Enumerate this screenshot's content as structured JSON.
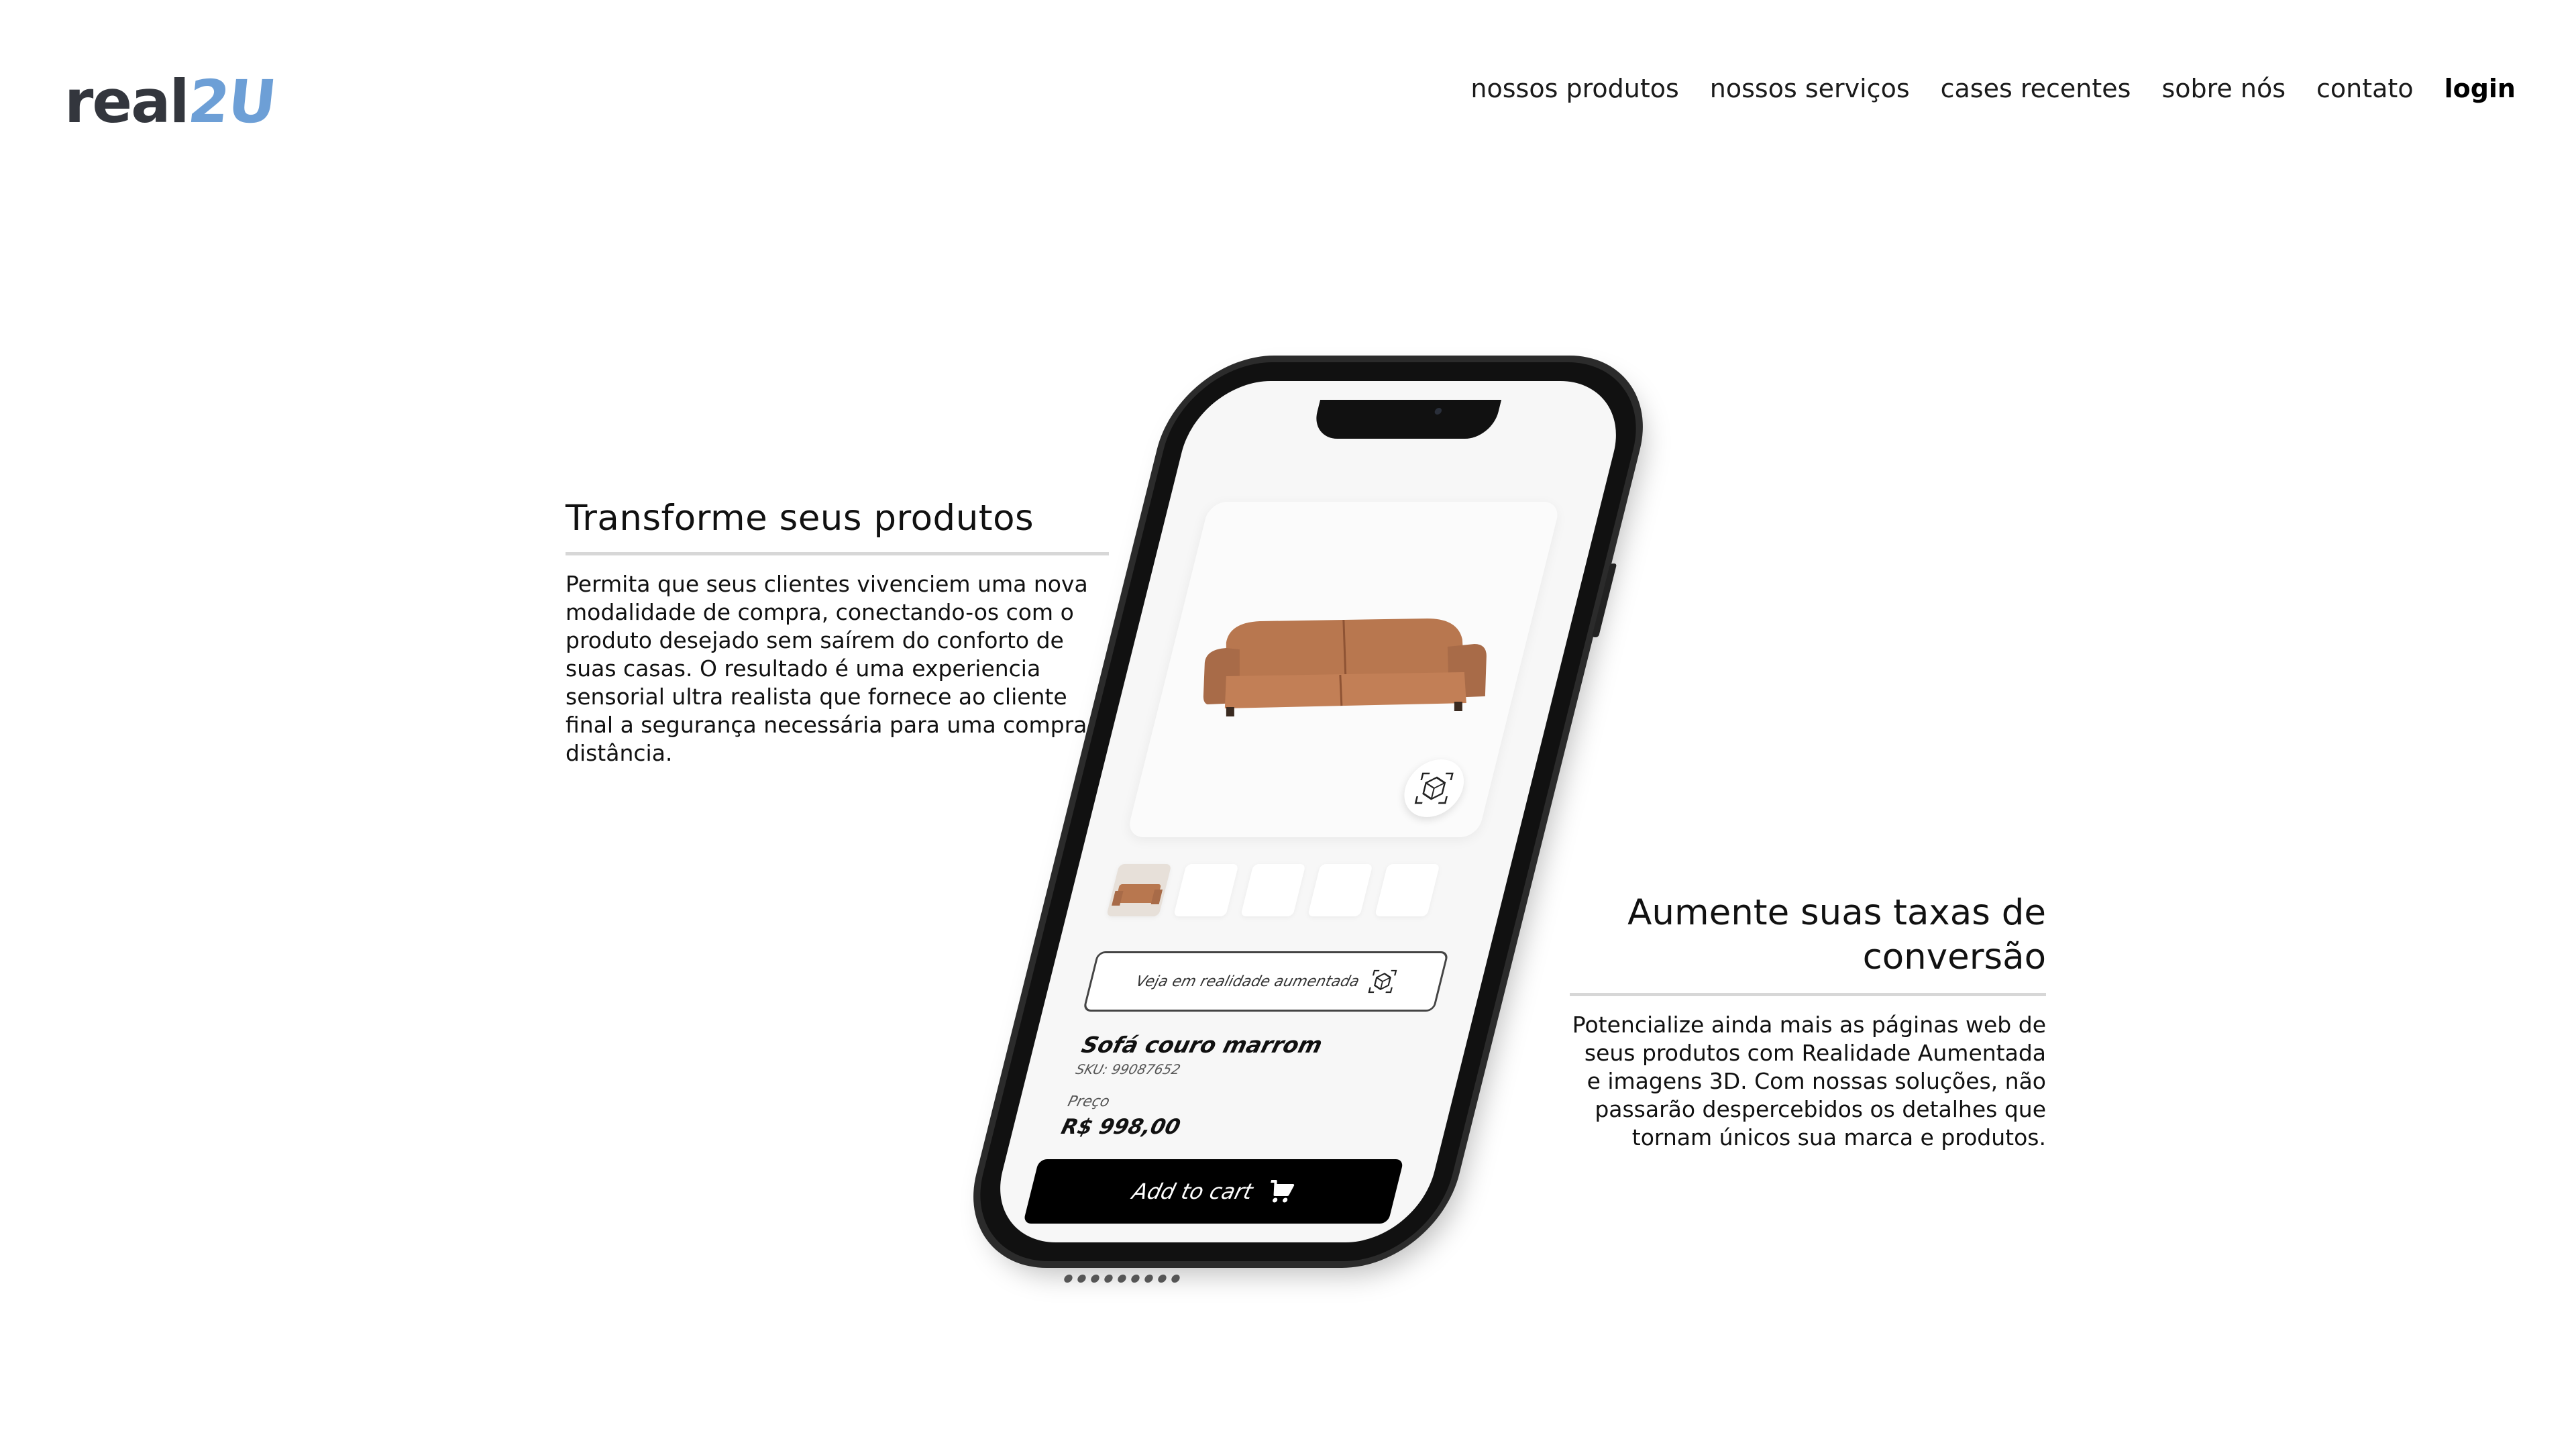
{
  "logo": {
    "part_a": "real",
    "part_b": "2U"
  },
  "nav": {
    "items": [
      "nossos produtos",
      "nossos serviços",
      "cases recentes",
      "sobre nós",
      "contato"
    ],
    "login": "login"
  },
  "section_left": {
    "title": "Transforme seus produtos",
    "body": "Permita que seus clientes vivenciem uma nova modalidade de compra, conectando-os com o produto desejado sem saírem do conforto de suas casas. O resultado é uma experiencia sensorial ultra realista que fornece ao cliente final a segurança necessária para uma compra a distância."
  },
  "section_right": {
    "title": "Aumente suas taxas de conversão",
    "body": "Potencialize ainda mais as páginas web de seus produtos com Realidade Aumentada e imagens 3D. Com nossas soluções, não passarão despercebidos os detalhes que tornam únicos sua marca e produtos."
  },
  "phone": {
    "ar_button": "Veja em realidade aumentada",
    "product_name": "Sofá couro marrom",
    "sku": "SKU: 99087652",
    "price_label": "Preço",
    "price": "R$ 998,00",
    "cart_button": "Add to cart"
  },
  "colors": {
    "logo_dark": "#33363d",
    "logo_blue": "#6d9fd6",
    "sofa": "#a86b48"
  }
}
